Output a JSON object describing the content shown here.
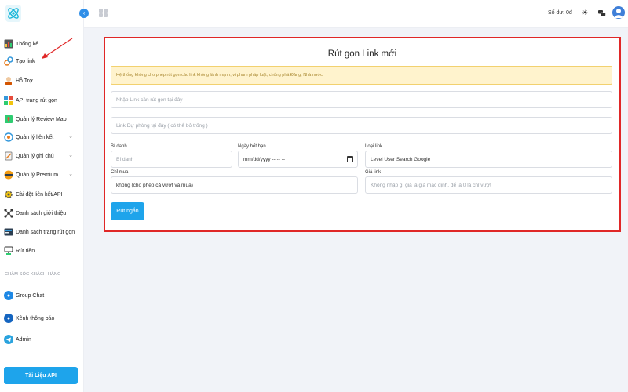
{
  "sidebar": {
    "items": [
      {
        "label": "Thống kê",
        "icon": "chart-icon"
      },
      {
        "label": "Tạo link",
        "icon": "link-icon"
      },
      {
        "label": "Hỗ Trợ",
        "icon": "support-icon"
      },
      {
        "label": "API trang rút gọn",
        "icon": "api-icon"
      },
      {
        "label": "Quản lý Review Map",
        "icon": "map-icon"
      },
      {
        "label": "Quản lý liên kết",
        "icon": "links-icon",
        "expandable": true
      },
      {
        "label": "Quản lý ghi chú",
        "icon": "note-icon",
        "expandable": true
      },
      {
        "label": "Quản lý Premium",
        "icon": "premium-icon",
        "expandable": true
      },
      {
        "label": "Cài đặt liên kết/API",
        "icon": "settings-icon"
      },
      {
        "label": "Danh sách giới thiệu",
        "icon": "referral-icon"
      },
      {
        "label": "Danh sách trang rút gọn",
        "icon": "pages-icon"
      },
      {
        "label": "Rút tiền",
        "icon": "withdraw-icon"
      }
    ],
    "section_heading": "CHĂM SÓC KHÁCH HÀNG",
    "support_items": [
      {
        "label": "Group Chat",
        "icon": "group-chat-icon"
      },
      {
        "label": "Kênh thông báo",
        "icon": "channel-icon"
      },
      {
        "label": "Admin",
        "icon": "telegram-icon"
      }
    ],
    "api_button": "Tài Liệu API"
  },
  "topbar": {
    "balance": "Số dư: 0đ",
    "icons": [
      "sun-icon",
      "chat-icon",
      "user-avatar"
    ]
  },
  "form": {
    "title": "Rút gọn Link mới",
    "notice": "Hệ thống không cho phép rút gọn các link không lành mạnh, vi phạm pháp luật, chống phá Đảng, Nhà nước.",
    "link_placeholder": "Nhập Link cần rút gọn tại đây",
    "backup_placeholder": "Link Dự phòng tại đây ( có thể bỏ trống )",
    "alias_label": "Bí danh",
    "alias_placeholder": "Bí danh",
    "expiry_label": "Ngày hết hạn",
    "expiry_value": "mm/dd/yyyy --:-- --",
    "type_label": "Loại link",
    "type_value": "Level User Search Google",
    "mode_label": "Chỉ mua",
    "mode_value": "không (cho phép cả vượt và mua)",
    "price_label": "Giá link",
    "price_placeholder": "Không nhập gì giá là giá mặc định, để là 0 là chỉ vượt",
    "submit_label": "Rút ngắn"
  },
  "colors": {
    "accent": "#1ea4eb",
    "highlight_border": "#e02727",
    "notice_bg": "#fff3cd"
  }
}
